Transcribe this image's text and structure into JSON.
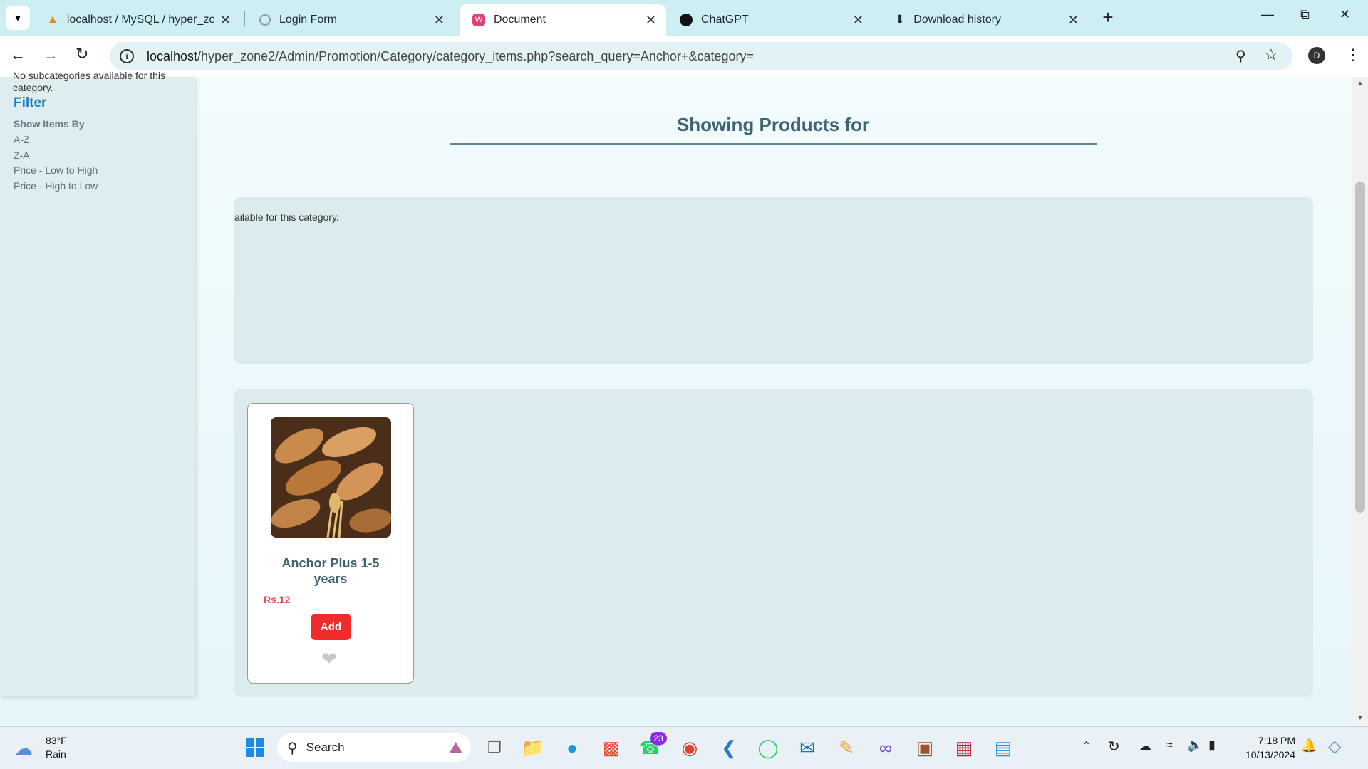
{
  "browser": {
    "tabs": [
      {
        "title": "localhost / MySQL / hyper_zone",
        "icon": "phpmyadmin-icon"
      },
      {
        "title": "Login Form",
        "icon": "loading-icon"
      },
      {
        "title": "Document",
        "icon": "document-icon",
        "active": true
      },
      {
        "title": "ChatGPT",
        "icon": "chatgpt-icon"
      },
      {
        "title": "Download history",
        "icon": "download-icon"
      }
    ],
    "url_host": "localhost",
    "url_path": "/hyper_zone2/Admin/Promotion/Category/category_items.php?search_query=Anchor+&category=",
    "profile_initial": "D"
  },
  "sidebar": {
    "no_sub_text": "No subcategories available for this category.",
    "filter_title": "Filter",
    "show_items_by": "Show Items By",
    "options": [
      "A-Z",
      "Z-A",
      "Price - Low to High",
      "Price - High to Low"
    ]
  },
  "main": {
    "heading": "Showing Products for",
    "subcat_text": "ailable for this category.",
    "product": {
      "name": "Anchor Plus 1-5 years",
      "price": "Rs.12",
      "add_label": "Add"
    }
  },
  "taskbar": {
    "weather_temp": "83°F",
    "weather_desc": "Rain",
    "search_label": "Search",
    "whatsapp_badge": "23",
    "time": "7:18 PM",
    "date": "10/13/2024"
  },
  "colors": {
    "accent_blue": "#1a7fc1",
    "heading": "#3d6470",
    "price_red": "#e0505a",
    "add_button": "#ef2b2b"
  }
}
